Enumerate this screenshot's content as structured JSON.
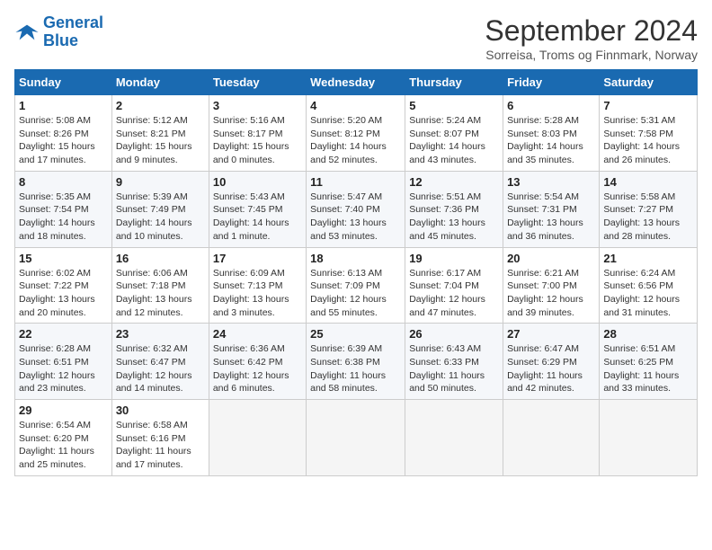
{
  "header": {
    "logo_line1": "General",
    "logo_line2": "Blue",
    "month_title": "September 2024",
    "subtitle": "Sorreisa, Troms og Finnmark, Norway"
  },
  "days_of_week": [
    "Sunday",
    "Monday",
    "Tuesday",
    "Wednesday",
    "Thursday",
    "Friday",
    "Saturday"
  ],
  "weeks": [
    [
      {
        "day": "1",
        "info": "Sunrise: 5:08 AM\nSunset: 8:26 PM\nDaylight: 15 hours and 17 minutes."
      },
      {
        "day": "2",
        "info": "Sunrise: 5:12 AM\nSunset: 8:21 PM\nDaylight: 15 hours and 9 minutes."
      },
      {
        "day": "3",
        "info": "Sunrise: 5:16 AM\nSunset: 8:17 PM\nDaylight: 15 hours and 0 minutes."
      },
      {
        "day": "4",
        "info": "Sunrise: 5:20 AM\nSunset: 8:12 PM\nDaylight: 14 hours and 52 minutes."
      },
      {
        "day": "5",
        "info": "Sunrise: 5:24 AM\nSunset: 8:07 PM\nDaylight: 14 hours and 43 minutes."
      },
      {
        "day": "6",
        "info": "Sunrise: 5:28 AM\nSunset: 8:03 PM\nDaylight: 14 hours and 35 minutes."
      },
      {
        "day": "7",
        "info": "Sunrise: 5:31 AM\nSunset: 7:58 PM\nDaylight: 14 hours and 26 minutes."
      }
    ],
    [
      {
        "day": "8",
        "info": "Sunrise: 5:35 AM\nSunset: 7:54 PM\nDaylight: 14 hours and 18 minutes."
      },
      {
        "day": "9",
        "info": "Sunrise: 5:39 AM\nSunset: 7:49 PM\nDaylight: 14 hours and 10 minutes."
      },
      {
        "day": "10",
        "info": "Sunrise: 5:43 AM\nSunset: 7:45 PM\nDaylight: 14 hours and 1 minute."
      },
      {
        "day": "11",
        "info": "Sunrise: 5:47 AM\nSunset: 7:40 PM\nDaylight: 13 hours and 53 minutes."
      },
      {
        "day": "12",
        "info": "Sunrise: 5:51 AM\nSunset: 7:36 PM\nDaylight: 13 hours and 45 minutes."
      },
      {
        "day": "13",
        "info": "Sunrise: 5:54 AM\nSunset: 7:31 PM\nDaylight: 13 hours and 36 minutes."
      },
      {
        "day": "14",
        "info": "Sunrise: 5:58 AM\nSunset: 7:27 PM\nDaylight: 13 hours and 28 minutes."
      }
    ],
    [
      {
        "day": "15",
        "info": "Sunrise: 6:02 AM\nSunset: 7:22 PM\nDaylight: 13 hours and 20 minutes."
      },
      {
        "day": "16",
        "info": "Sunrise: 6:06 AM\nSunset: 7:18 PM\nDaylight: 13 hours and 12 minutes."
      },
      {
        "day": "17",
        "info": "Sunrise: 6:09 AM\nSunset: 7:13 PM\nDaylight: 13 hours and 3 minutes."
      },
      {
        "day": "18",
        "info": "Sunrise: 6:13 AM\nSunset: 7:09 PM\nDaylight: 12 hours and 55 minutes."
      },
      {
        "day": "19",
        "info": "Sunrise: 6:17 AM\nSunset: 7:04 PM\nDaylight: 12 hours and 47 minutes."
      },
      {
        "day": "20",
        "info": "Sunrise: 6:21 AM\nSunset: 7:00 PM\nDaylight: 12 hours and 39 minutes."
      },
      {
        "day": "21",
        "info": "Sunrise: 6:24 AM\nSunset: 6:56 PM\nDaylight: 12 hours and 31 minutes."
      }
    ],
    [
      {
        "day": "22",
        "info": "Sunrise: 6:28 AM\nSunset: 6:51 PM\nDaylight: 12 hours and 23 minutes."
      },
      {
        "day": "23",
        "info": "Sunrise: 6:32 AM\nSunset: 6:47 PM\nDaylight: 12 hours and 14 minutes."
      },
      {
        "day": "24",
        "info": "Sunrise: 6:36 AM\nSunset: 6:42 PM\nDaylight: 12 hours and 6 minutes."
      },
      {
        "day": "25",
        "info": "Sunrise: 6:39 AM\nSunset: 6:38 PM\nDaylight: 11 hours and 58 minutes."
      },
      {
        "day": "26",
        "info": "Sunrise: 6:43 AM\nSunset: 6:33 PM\nDaylight: 11 hours and 50 minutes."
      },
      {
        "day": "27",
        "info": "Sunrise: 6:47 AM\nSunset: 6:29 PM\nDaylight: 11 hours and 42 minutes."
      },
      {
        "day": "28",
        "info": "Sunrise: 6:51 AM\nSunset: 6:25 PM\nDaylight: 11 hours and 33 minutes."
      }
    ],
    [
      {
        "day": "29",
        "info": "Sunrise: 6:54 AM\nSunset: 6:20 PM\nDaylight: 11 hours and 25 minutes."
      },
      {
        "day": "30",
        "info": "Sunrise: 6:58 AM\nSunset: 6:16 PM\nDaylight: 11 hours and 17 minutes."
      },
      {
        "day": "",
        "info": ""
      },
      {
        "day": "",
        "info": ""
      },
      {
        "day": "",
        "info": ""
      },
      {
        "day": "",
        "info": ""
      },
      {
        "day": "",
        "info": ""
      }
    ]
  ]
}
